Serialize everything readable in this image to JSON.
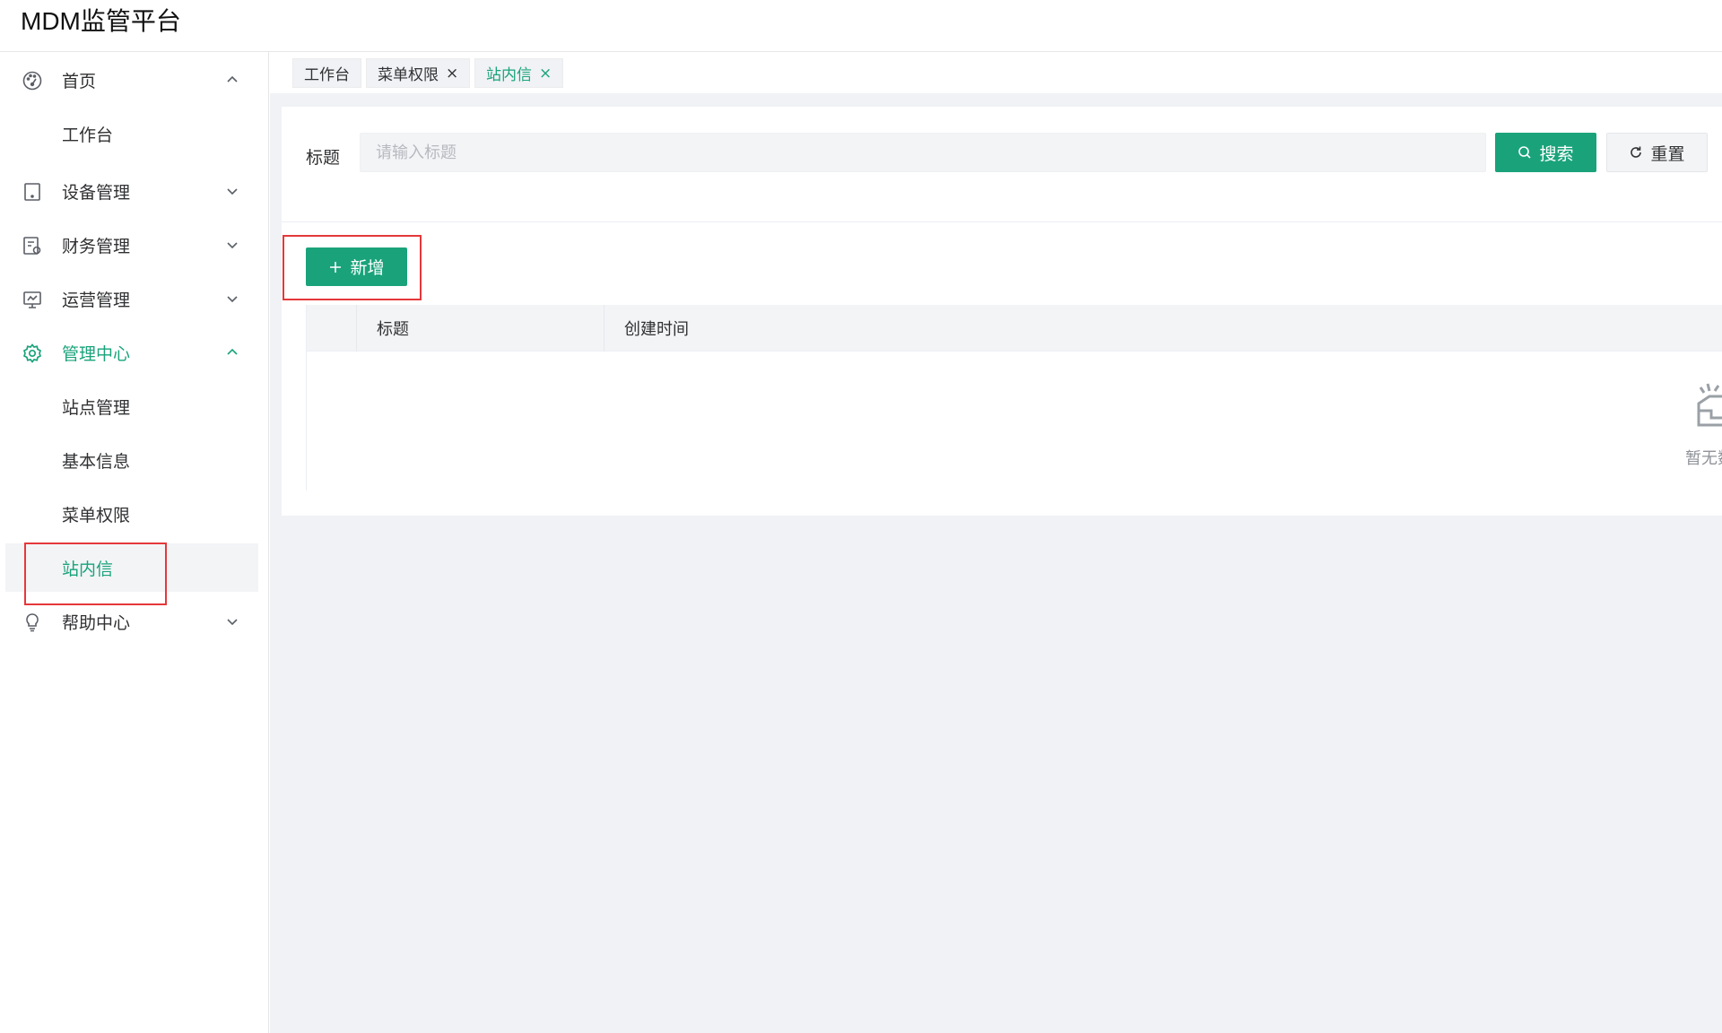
{
  "app": {
    "title": "MDM监管平台"
  },
  "sidebar": {
    "items": [
      {
        "label": "首页",
        "icon": "dashboard-icon",
        "expanded": true,
        "active": false,
        "children": [
          {
            "label": "工作台",
            "active": false
          }
        ]
      },
      {
        "label": "设备管理",
        "icon": "device-icon",
        "expanded": false,
        "active": false
      },
      {
        "label": "财务管理",
        "icon": "finance-icon",
        "expanded": false,
        "active": false
      },
      {
        "label": "运营管理",
        "icon": "monitor-icon",
        "expanded": false,
        "active": false
      },
      {
        "label": "管理中心",
        "icon": "gear-icon",
        "expanded": true,
        "active": true,
        "children": [
          {
            "label": "站点管理",
            "active": false
          },
          {
            "label": "基本信息",
            "active": false
          },
          {
            "label": "菜单权限",
            "active": false
          },
          {
            "label": "站内信",
            "active": true
          }
        ]
      },
      {
        "label": "帮助中心",
        "icon": "lightbulb-icon",
        "expanded": false,
        "active": false
      }
    ]
  },
  "tabs": [
    {
      "label": "工作台",
      "closable": false,
      "active": false
    },
    {
      "label": "菜单权限",
      "closable": true,
      "active": false
    },
    {
      "label": "站内信",
      "closable": true,
      "active": true
    }
  ],
  "tab_close_glyph": "×",
  "search": {
    "label": "标题",
    "placeholder": "请输入标题",
    "value": "",
    "search_button": "搜索",
    "reset_button": "重置"
  },
  "toolbar": {
    "add_button": "新增"
  },
  "table": {
    "columns": [
      "标题",
      "创建时间"
    ],
    "rows": [],
    "empty_text": "暂无数"
  },
  "colors": {
    "accent": "#1aa37b",
    "annotation": "#e5383b",
    "background": "#f0f2f5"
  }
}
